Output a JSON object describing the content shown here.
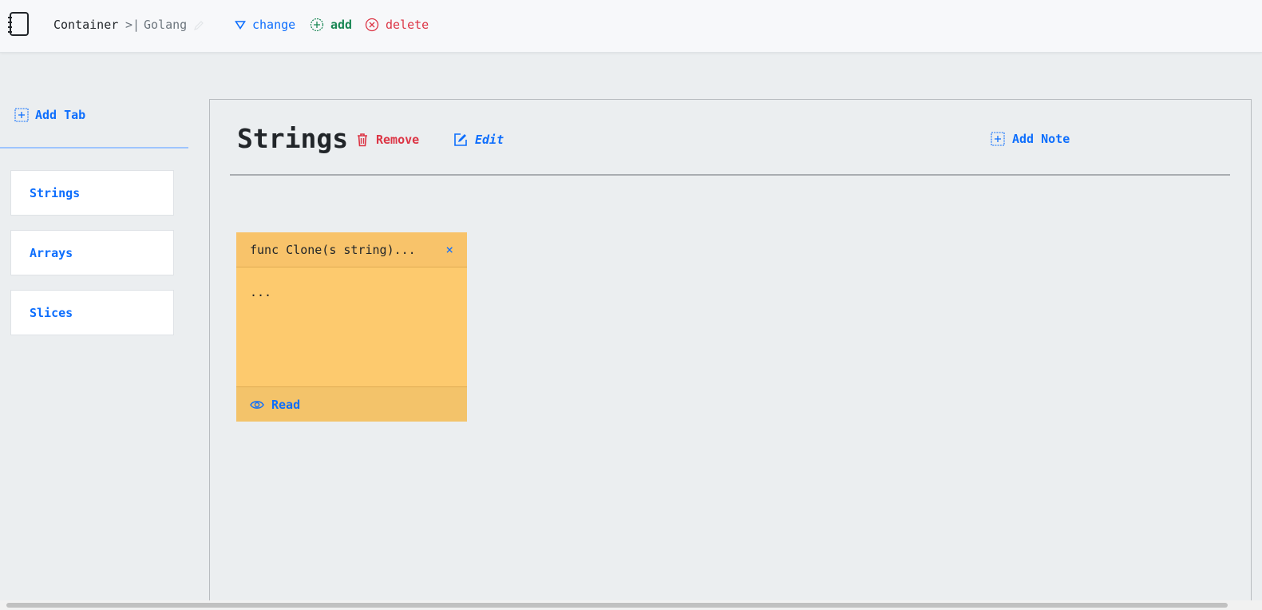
{
  "topbar": {
    "logo_icon": "notebook-icon",
    "container_label": "Container",
    "separator": ">|",
    "current_container": "Golang",
    "actions": {
      "change": "change",
      "add": "add",
      "delete": "delete"
    }
  },
  "sidebar": {
    "add_tab_label": "Add Tab",
    "tabs": [
      {
        "label": "Strings"
      },
      {
        "label": "Arrays"
      },
      {
        "label": "Slices"
      }
    ]
  },
  "main": {
    "title": "Strings",
    "remove_label": "Remove",
    "edit_label": "Edit",
    "add_note_label": "Add Note",
    "notes": [
      {
        "title": "func Clone(s string)...",
        "close": "×",
        "body": "...",
        "read_label": "Read"
      }
    ]
  },
  "colors": {
    "primary": "#0d6efd",
    "success": "#198754",
    "danger": "#dc3545",
    "note": "#fdca6e",
    "background": "#ebeef0"
  }
}
